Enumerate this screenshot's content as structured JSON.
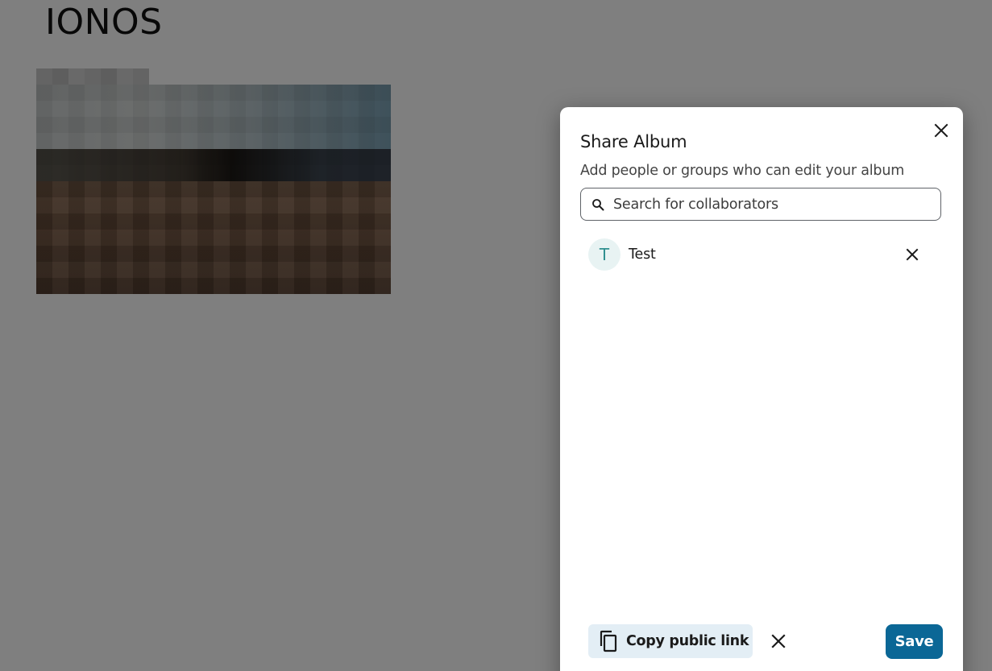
{
  "page": {
    "album_title": "IONOS"
  },
  "dialog": {
    "title": "Share Album",
    "subtitle": "Add people or groups who can edit your album",
    "close_icon": "close-icon",
    "search": {
      "placeholder": "Search for collaborators",
      "value": "",
      "icon": "search-icon"
    },
    "collaborators": [
      {
        "initial": "T",
        "name": "Test",
        "remove_icon": "close-icon"
      }
    ],
    "footer": {
      "copy_link_label": "Copy public link",
      "copy_icon": "copy-icon",
      "remove_link_icon": "close-icon",
      "save_label": "Save"
    }
  },
  "colors": {
    "overlay": "#808080",
    "save_button": "#0b6796",
    "copy_link_button": "#e3eef5",
    "avatar_bg": "#e8f3f3",
    "avatar_text": "#2f8f8f"
  }
}
